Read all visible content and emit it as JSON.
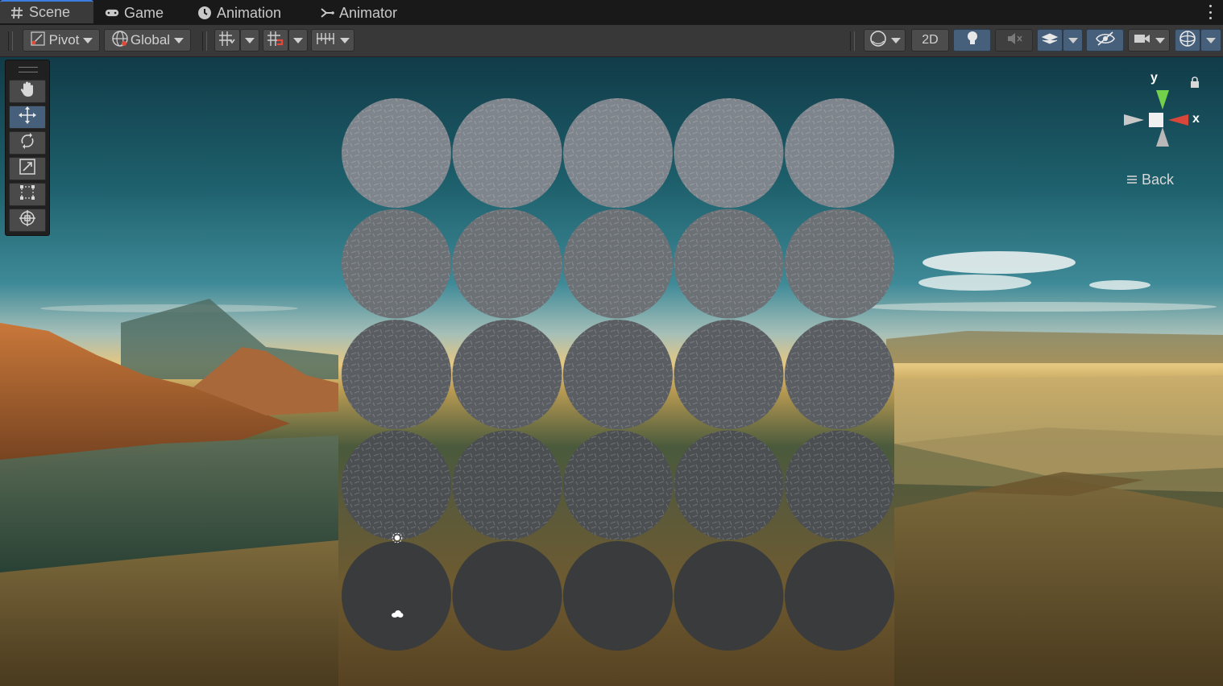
{
  "tabs": [
    {
      "label": "Scene",
      "icon": "hash-icon",
      "active": true
    },
    {
      "label": "Game",
      "icon": "gamepad-icon",
      "active": false
    },
    {
      "label": "Animation",
      "icon": "clock-icon",
      "active": false
    },
    {
      "label": "Animator",
      "icon": "animator-icon",
      "active": false
    }
  ],
  "toolbar": {
    "pivot_label": "Pivot",
    "global_label": "Global",
    "mode_2d_label": "2D"
  },
  "tools": [
    "hand-tool",
    "move-tool",
    "rotate-tool",
    "scale-tool",
    "rect-tool",
    "transform-tool"
  ],
  "active_tool": "move-tool",
  "gizmo": {
    "y_label": "y",
    "x_label": "x",
    "view_label": "Back"
  },
  "scene": {
    "grid_rows": 5,
    "grid_cols": 5,
    "colors": {
      "accent": "#3c7ee0",
      "active_button": "#46607c",
      "axis_y": "#72d04a",
      "axis_x": "#d8473a"
    }
  }
}
